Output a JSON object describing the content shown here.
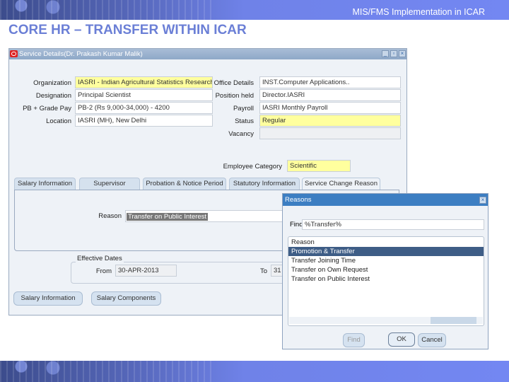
{
  "header": {
    "subtitle": "MIS/FMS Implementation in ICAR",
    "title": "CORE HR – TRANSFER WITHIN ICAR"
  },
  "window": {
    "title": "Service Details(Dr. Prakash Kumar Malik)",
    "left_fields": [
      {
        "label": "Organization",
        "value": "IASRI - Indian Agricultural Statistics Research"
      },
      {
        "label": "Designation",
        "value": "Principal Scientist"
      },
      {
        "label": "PB + Grade Pay",
        "value": "PB-2 (Rs 9,000-34,000) - 4200"
      },
      {
        "label": "Location",
        "value": "IASRI (MH), New Delhi"
      }
    ],
    "right_fields": [
      {
        "label": "Office Details",
        "value": "INST.Computer Applications.."
      },
      {
        "label": "Position held",
        "value": "Director.IASRI"
      },
      {
        "label": "Payroll",
        "value": "IASRI Monthly Payroll"
      },
      {
        "label": "Status",
        "value": "Regular"
      },
      {
        "label": "Vacancy",
        "value": ""
      }
    ],
    "employee_category": {
      "label": "Employee Category",
      "value": "Scientific"
    },
    "tabs": [
      "Salary Information",
      "Supervisor",
      "Probation & Notice Period",
      "Statutory Information",
      "Service Change Reason"
    ],
    "reason": {
      "label": "Reason",
      "value": "Transfer on Public Interest"
    },
    "effective_dates": {
      "legend": "Effective Dates",
      "from_label": "From",
      "from_value": "30-APR-2013",
      "to_label": "To",
      "to_value": "31"
    },
    "buttons": [
      "Salary Information",
      "Salary Components"
    ]
  },
  "dialog": {
    "title": "Reasons",
    "find_label": "Find",
    "find_value": "%Transfer%",
    "column": "Reason",
    "items": [
      "Promotion & Transfer",
      "Transfer Joining Time",
      "Transfer on Own Request",
      "Transfer on Public Interest"
    ],
    "selected": 0,
    "buttons": {
      "find": "Find",
      "ok": "OK",
      "cancel": "Cancel"
    }
  }
}
